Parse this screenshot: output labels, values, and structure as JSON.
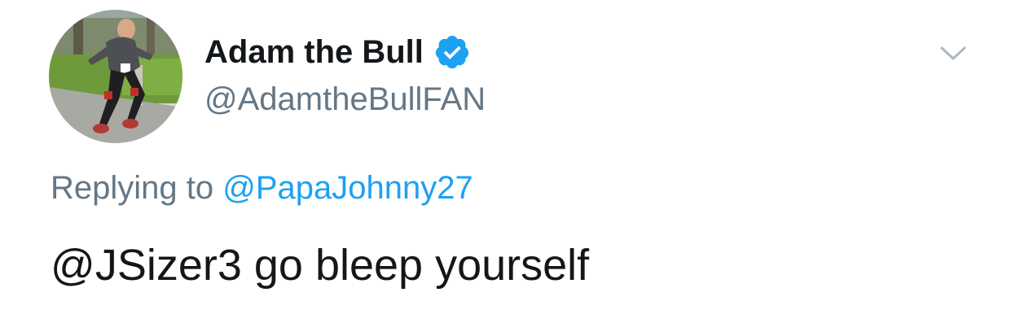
{
  "tweet": {
    "author": {
      "display_name": "Adam the Bull",
      "handle": "@AdamtheBullFAN",
      "verified": true,
      "avatar_alt": "profile photo of a man running in a park"
    },
    "reply_prefix": "Replying to",
    "reply_to": "@PapaJohnny27",
    "text": "@JSizer3 go bleep yourself",
    "icons": {
      "verified": "verified-badge-icon",
      "menu": "chevron-down-icon"
    },
    "colors": {
      "link": "#1da1f2",
      "secondary": "#657786",
      "primary": "#14171a"
    }
  }
}
